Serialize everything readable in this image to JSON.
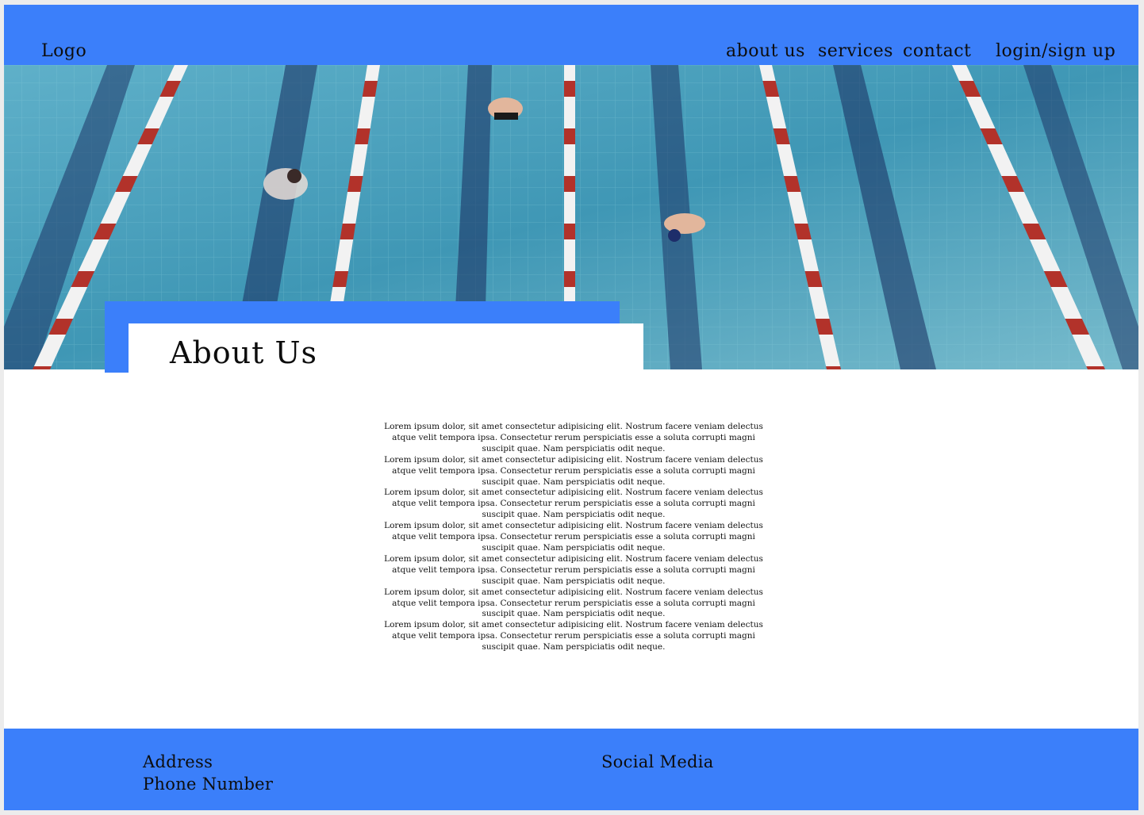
{
  "header": {
    "logo": "Logo",
    "nav": {
      "about": "about us",
      "services": "services",
      "contact": "contact",
      "login": "login/sign up"
    }
  },
  "hero": {
    "image_description_icon": "pool-lanes-swimmers-image"
  },
  "about": {
    "title": "About Us",
    "paragraphs": [
      "Lorem ipsum dolor, sit amet consectetur adipisicing elit. Nostrum facere veniam delectus atque velit tempora ipsa. Consectetur rerum perspiciatis esse a soluta corrupti magni suscipit quae. Nam perspiciatis odit neque.",
      "Lorem ipsum dolor, sit amet consectetur adipisicing elit. Nostrum facere veniam delectus atque velit tempora ipsa. Consectetur rerum perspiciatis esse a soluta corrupti magni suscipit quae. Nam perspiciatis odit neque.",
      "Lorem ipsum dolor, sit amet consectetur adipisicing elit. Nostrum facere veniam delectus atque velit tempora ipsa. Consectetur rerum perspiciatis esse a soluta corrupti magni suscipit quae. Nam perspiciatis odit neque.",
      "Lorem ipsum dolor, sit amet consectetur adipisicing elit. Nostrum facere veniam delectus atque velit tempora ipsa. Consectetur rerum perspiciatis esse a soluta corrupti magni suscipit quae. Nam perspiciatis odit neque.",
      "Lorem ipsum dolor, sit amet consectetur adipisicing elit. Nostrum facere veniam delectus atque velit tempora ipsa. Consectetur rerum perspiciatis esse a soluta corrupti magni suscipit quae. Nam perspiciatis odit neque.",
      "Lorem ipsum dolor, sit amet consectetur adipisicing elit. Nostrum facere veniam delectus atque velit tempora ipsa. Consectetur rerum perspiciatis esse a soluta corrupti magni suscipit quae. Nam perspiciatis odit neque.",
      "Lorem ipsum dolor, sit amet consectetur adipisicing elit. Nostrum facere veniam delectus atque velit tempora ipsa. Consectetur rerum perspiciatis esse a soluta corrupti magni suscipit quae. Nam perspiciatis odit neque."
    ]
  },
  "footer": {
    "address": "Address",
    "phone": "Phone Number",
    "social": "Social Media"
  },
  "colors": {
    "accent": "#3b7ffa",
    "page_bg": "#ffffff",
    "water": "#4da2bf",
    "lane_red": "#b2322a",
    "lane_navy": "#1d3566"
  }
}
